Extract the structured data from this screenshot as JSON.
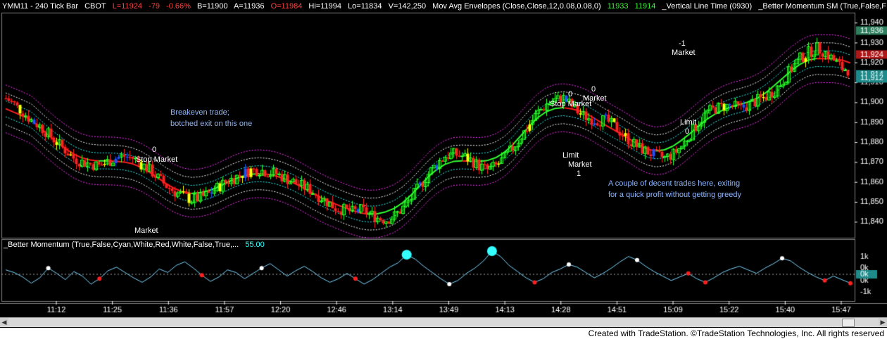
{
  "header": {
    "symbol": "YMM11 - 240 Tick Bar",
    "exchange": "CBOT",
    "last": "L=11924",
    "change": "-79",
    "pct": "-0.66%",
    "bid": "B=11900",
    "ask": "A=11936",
    "open": "O=11984",
    "high": "Hi=11994",
    "low": "Lo=11834",
    "volume": "V=142,250",
    "env_label": "Mov Avg Envelopes (Close,Close,12,0.08,0.08,0)",
    "env_v1": "11933",
    "env_v2": "11914",
    "vline_label": "_Vertical Line Time (0930)",
    "bm_label": "_Better Momentum SM (True,False,F"
  },
  "sub_header": {
    "label": "_Better Momentum (True,False,Cyan,White,Red,White,False,True,...",
    "value": "55.00"
  },
  "annotations": [
    {
      "id": "a1",
      "text": "0"
    },
    {
      "id": "a2",
      "text": "Stop Market"
    },
    {
      "id": "a3",
      "text": "Market"
    },
    {
      "id": "a4",
      "text": "0"
    },
    {
      "id": "a5",
      "text": "Stop Market"
    },
    {
      "id": "a6",
      "text": "0"
    },
    {
      "id": "a7",
      "text": "Market"
    },
    {
      "id": "a8",
      "text": "Limit"
    },
    {
      "id": "a9",
      "text": "Market"
    },
    {
      "id": "a10",
      "text": "1"
    },
    {
      "id": "a11",
      "text": "-1"
    },
    {
      "id": "a12",
      "text": "Market"
    },
    {
      "id": "a13",
      "text": "Limit"
    },
    {
      "id": "a14",
      "text": "0"
    }
  ],
  "notes": {
    "left_1": "Breakeven trade;",
    "left_2": "botched exit on this one",
    "right_1": "A couple of decent trades here, exiting",
    "right_2": "for a quick profit without getting greedy"
  },
  "footer": "Created with TradeStation. ©TradeStation Technologies, Inc. All rights reserved",
  "colors": {
    "up_candle": "#33ff33",
    "down_candle": "#ff2020",
    "neutral_candle": "#ffff00",
    "blue_candle": "#2050ff",
    "env_outer": "#ff33ff",
    "env_mid": "#ffffff",
    "env_inner": "#33ffff",
    "momentum_line": "#7fd8ff",
    "axis_text": "#ffffff"
  },
  "chart_data": {
    "type": "line",
    "title": "YMM11 - 240 Tick Bar",
    "price_axis": {
      "ticks": [
        11840,
        11850,
        11860,
        11870,
        11880,
        11890,
        11900,
        11910,
        11920,
        11930,
        11940
      ],
      "ylim": [
        11832,
        11945
      ]
    },
    "right_labels": [
      {
        "text": "11,940",
        "value": 11940
      },
      {
        "text": "11,930",
        "value": 11930
      },
      {
        "text": "11,920",
        "value": 11920
      },
      {
        "text": "11,910",
        "value": 11910
      },
      {
        "text": "11,900",
        "value": 11900
      },
      {
        "text": "11,890",
        "value": 11890
      },
      {
        "text": "11,880",
        "value": 11880
      },
      {
        "text": "11,870",
        "value": 11870
      },
      {
        "text": "11,860",
        "value": 11860
      },
      {
        "text": "11,850",
        "value": 11850
      },
      {
        "text": "11,840",
        "value": 11840
      }
    ],
    "price_badges": [
      {
        "text": "11,936",
        "value": 11936,
        "color": "#2e7f5e"
      },
      {
        "text": "11,924",
        "value": 11924,
        "color": "#b01818"
      },
      {
        "text": "11,914",
        "value": 11914,
        "color": "#1e8a8a"
      },
      {
        "text": "11,912",
        "value": 11912,
        "color": "#1e8a8a"
      }
    ],
    "time_labels": [
      "11:12",
      "11:25",
      "11:36",
      "11:57",
      "12:20",
      "12:46",
      "13:14",
      "13:49",
      "14:13",
      "14:28",
      "14:51",
      "15:09",
      "15:22",
      "15:40",
      "15:47"
    ],
    "close": [
      11902,
      11899,
      11895,
      11891,
      11888,
      11884,
      11880,
      11876,
      11872,
      11870,
      11869,
      11868,
      11870,
      11872,
      11873,
      11872,
      11869,
      11866,
      11862,
      11858,
      11855,
      11853,
      11851,
      11852,
      11854,
      11857,
      11860,
      11862,
      11864,
      11866,
      11866,
      11865,
      11864,
      11862,
      11860,
      11858,
      11856,
      11853,
      11850,
      11847,
      11846,
      11845,
      11846,
      11844,
      11842,
      11841,
      11843,
      11847,
      11852,
      11858,
      11864,
      11869,
      11873,
      11874,
      11873,
      11871,
      11868,
      11866,
      11868,
      11872,
      11877,
      11883,
      11889,
      11895,
      11899,
      11901,
      11902,
      11898,
      11894,
      11892,
      11891,
      11891,
      11888,
      11884,
      11880,
      11877,
      11875,
      11873,
      11872,
      11874,
      11878,
      11884,
      11890,
      11895,
      11897,
      11898,
      11898,
      11897,
      11899,
      11901,
      11903,
      11906,
      11911,
      11917,
      11922,
      11925,
      11927,
      11925,
      11921,
      11917,
      11916
    ],
    "momentum": {
      "axis_ticks": [
        "1k",
        "0k",
        "0k",
        "-1k"
      ],
      "zero_label": "0k",
      "values": [
        10,
        4,
        -6,
        -20,
        -8,
        14,
        2,
        -12,
        6,
        -4,
        -22,
        -10,
        8,
        16,
        4,
        -8,
        -18,
        -6,
        12,
        4,
        20,
        28,
        14,
        -2,
        -16,
        -6,
        10,
        4,
        -10,
        2,
        14,
        24,
        10,
        -4,
        8,
        18,
        6,
        -8,
        -18,
        -10,
        2,
        -10,
        -22,
        -12,
        2,
        16,
        26,
        44,
        34,
        18,
        4,
        -10,
        -22,
        -14,
        2,
        14,
        30,
        52,
        40,
        20,
        6,
        -8,
        -18,
        -10,
        4,
        12,
        22,
        16,
        4,
        -8,
        2,
        14,
        28,
        40,
        32,
        18,
        6,
        -4,
        -14,
        -6,
        2,
        -10,
        -18,
        -8,
        4,
        12,
        18,
        10,
        2,
        14,
        24,
        36,
        30,
        16,
        4,
        -6,
        -14,
        -4,
        -12,
        -20
      ],
      "markers": [
        {
          "i": 5,
          "kind": "white"
        },
        {
          "i": 11,
          "kind": "red"
        },
        {
          "i": 23,
          "kind": "red"
        },
        {
          "i": 30,
          "kind": "white"
        },
        {
          "i": 41,
          "kind": "red"
        },
        {
          "i": 47,
          "kind": "cyan_big"
        },
        {
          "i": 52,
          "kind": "white"
        },
        {
          "i": 57,
          "kind": "cyan_big"
        },
        {
          "i": 62,
          "kind": "red"
        },
        {
          "i": 66,
          "kind": "white"
        },
        {
          "i": 74,
          "kind": "white"
        },
        {
          "i": 80,
          "kind": "red"
        },
        {
          "i": 82,
          "kind": "red"
        },
        {
          "i": 91,
          "kind": "white"
        },
        {
          "i": 96,
          "kind": "red"
        },
        {
          "i": 99,
          "kind": "red"
        }
      ]
    }
  }
}
